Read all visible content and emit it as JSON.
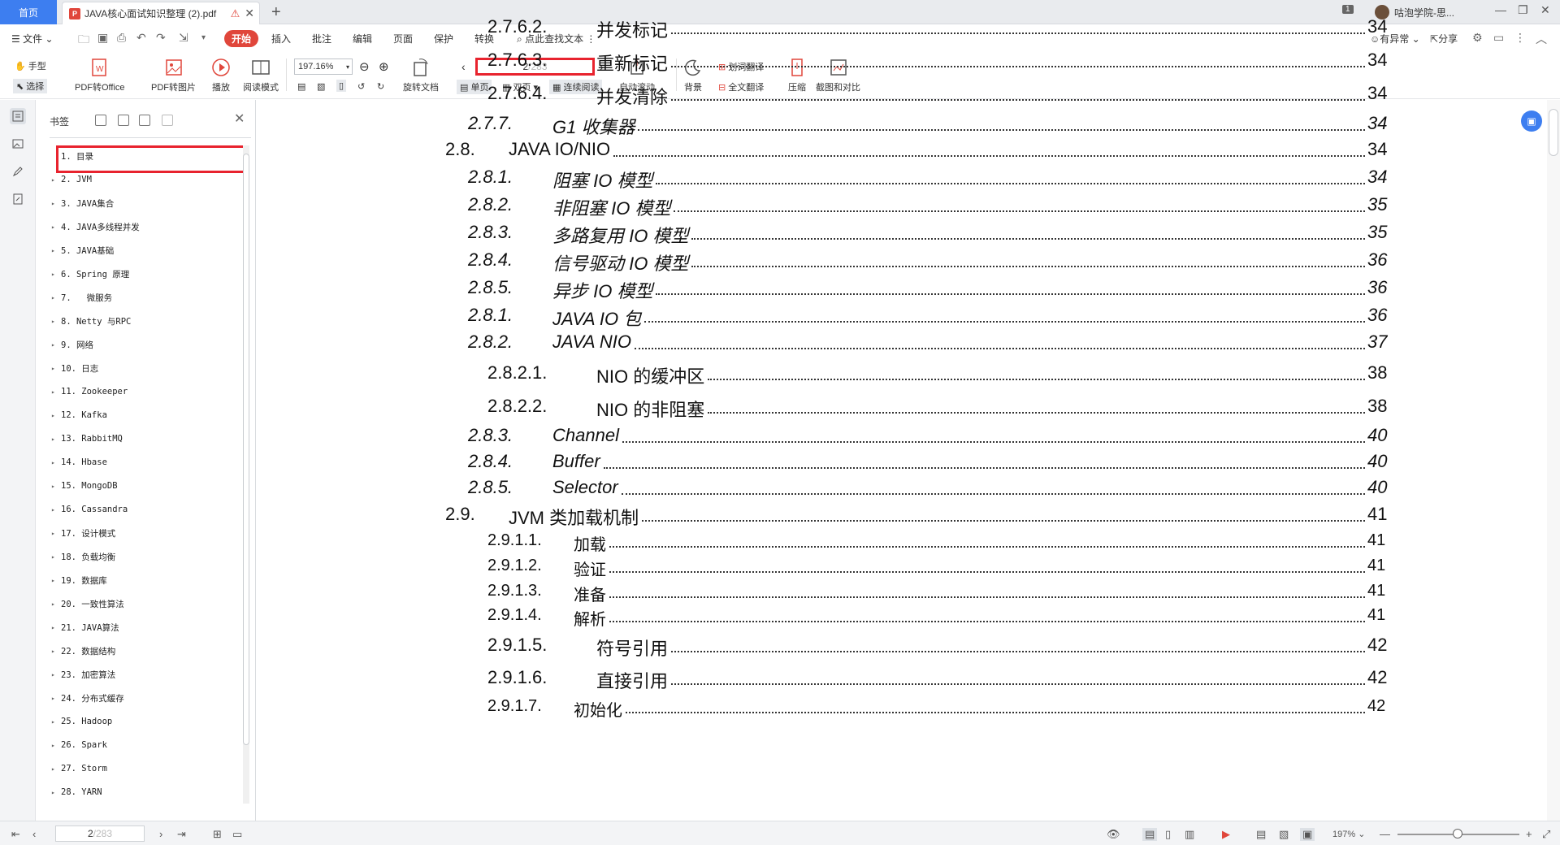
{
  "tabbar": {
    "home_label": "首页",
    "doc_tab_label": "JAVA核心面试知识整理 (2).pdf",
    "page_badge": "1",
    "user_name": "咕泡学院-思..."
  },
  "menu": {
    "file_label": "文件",
    "start_label": "开始",
    "items": [
      "插入",
      "批注",
      "编辑",
      "页面",
      "保护",
      "转换"
    ],
    "search_label": "点此查找文本",
    "anomaly_label": "有异常",
    "share_label": "分享"
  },
  "ribbon": {
    "hand_label": "手型",
    "select_label": "选择",
    "pdf_to_office": "PDF转Office",
    "pdf_to_image": "PDF转图片",
    "play": "播放",
    "read_mode": "阅读模式",
    "zoom_value": "197.16%",
    "rotate_doc": "旋转文档",
    "page_current": "2",
    "page_total": "/283",
    "single_page": "单页",
    "double_page": "双页",
    "continuous": "连续阅读",
    "auto_scroll": "自动滚动",
    "background": "背景",
    "word_translate": "划词翻译",
    "full_translate": "全文翻译",
    "compress": "压缩",
    "screenshot_compare": "截图和对比"
  },
  "bookmarks": {
    "title": "书签",
    "items": [
      "1. 目录",
      "2. JVM",
      "3. JAVA集合",
      "4. JAVA多线程并发",
      "5. JAVA基础",
      "6. Spring 原理",
      "7.   微服务",
      "8. Netty 与RPC",
      "9. 网络",
      "10. 日志",
      "11. Zookeeper",
      "12. Kafka",
      "13. RabbitMQ",
      "14. Hbase",
      "15. MongoDB",
      "16. Cassandra",
      "17. 设计模式",
      "18. 负载均衡",
      "19. 数据库",
      "20. 一致性算法",
      "21. JAVA算法",
      "22. 数据结构",
      "23. 加密算法",
      "24. 分布式缓存",
      "25. Hadoop",
      "26. Spark",
      "27. Storm",
      "28. YARN"
    ]
  },
  "toc": [
    {
      "num": "2.7.6.2.",
      "text": "并发标记",
      "page": "34"
    },
    {
      "num": "2.7.6.3.",
      "text": "重新标记",
      "page": "34"
    },
    {
      "num": "2.7.6.4.",
      "text": "并发清除",
      "page": "34"
    },
    {
      "num": "2.7.7.",
      "text": "G1 收集器",
      "page": "34"
    },
    {
      "num": "2.8.",
      "text": "JAVA IO/NIO",
      "page": "34"
    },
    {
      "num": "2.8.1.",
      "text": "阻塞 IO 模型",
      "page": "34"
    },
    {
      "num": "2.8.2.",
      "text": "非阻塞 IO 模型",
      "page": "35"
    },
    {
      "num": "2.8.3.",
      "text": "多路复用 IO 模型",
      "page": "35"
    },
    {
      "num": "2.8.4.",
      "text": "信号驱动 IO 模型",
      "page": "36"
    },
    {
      "num": "2.8.5.",
      "text": "异步 IO 模型",
      "page": "36"
    },
    {
      "num": "2.8.1.",
      "text": "JAVA IO 包",
      "page": "36"
    },
    {
      "num": "2.8.2.",
      "text": "JAVA NIO",
      "page": "37"
    },
    {
      "num": "2.8.2.1.",
      "text": "NIO 的缓冲区",
      "page": "38"
    },
    {
      "num": "2.8.2.2.",
      "text": "NIO 的非阻塞",
      "page": "38"
    },
    {
      "num": "2.8.3.",
      "text": "Channel",
      "page": "40"
    },
    {
      "num": "2.8.4.",
      "text": "Buffer",
      "page": "40"
    },
    {
      "num": "2.8.5.",
      "text": "Selector",
      "page": "40"
    },
    {
      "num": "2.9.",
      "text": "JVM 类加载机制",
      "page": "41"
    },
    {
      "num": "2.9.1.1.",
      "text": "加载",
      "page": "41"
    },
    {
      "num": "2.9.1.2.",
      "text": "验证",
      "page": "41"
    },
    {
      "num": "2.9.1.3.",
      "text": "准备",
      "page": "41"
    },
    {
      "num": "2.9.1.4.",
      "text": "解析",
      "page": "41"
    },
    {
      "num": "2.9.1.5.",
      "text": "符号引用",
      "page": "42"
    },
    {
      "num": "2.9.1.6.",
      "text": "直接引用",
      "page": "42"
    },
    {
      "num": "2.9.1.7.",
      "text": "初始化",
      "page": "42"
    }
  ],
  "status": {
    "page_current": "2",
    "page_total": "/283",
    "zoom_label": "197%"
  },
  "colors": {
    "accent": "#3d7ef0",
    "highlight": "#e8232e",
    "start_button": "#e0463b"
  }
}
